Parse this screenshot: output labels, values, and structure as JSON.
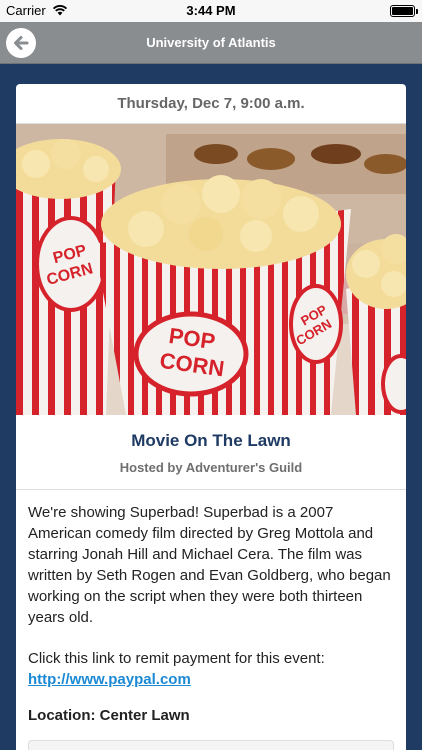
{
  "status_bar": {
    "carrier": "Carrier",
    "time": "3:44 PM"
  },
  "nav": {
    "title": "University of Atlantis",
    "back_icon": "back-arrow-circle-icon"
  },
  "event": {
    "date": "Thursday, Dec 7, 9:00 a.m.",
    "image_alt": "popcorn boxes",
    "popcorn_label_line1": "POP",
    "popcorn_label_line2": "CORN",
    "title": "Movie On The Lawn",
    "host": "Hosted by Adventurer's Guild",
    "description": "We're showing Superbad! Superbad is a 2007 American comedy film directed by Greg Mottola and starring Jonah Hill and Michael Cera. The film was written by Seth Rogen and Evan Goldberg, who began working on the script when they were both thirteen years old.",
    "payment_text": "Click this link to remit payment for this event:",
    "payment_link": "http://www.paypal.com",
    "location": "Location: Center Lawn"
  },
  "colors": {
    "background": "#1f3b63",
    "nav_bar": "#8a8d90",
    "title": "#1f3b63",
    "link": "#1c89d4"
  }
}
